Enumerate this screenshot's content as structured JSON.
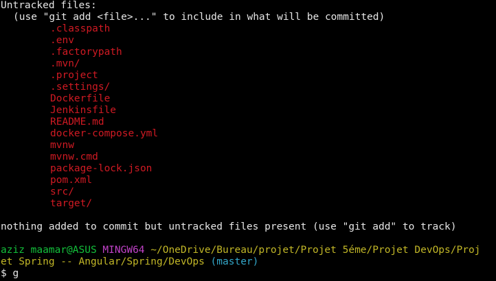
{
  "terminal": {
    "colors": {
      "background": "#000000",
      "text": "#e6e6e6",
      "untracked_file": "#d01a23",
      "prompt_user": "#13c13b",
      "prompt_system": "#c142c8",
      "prompt_path": "#c2b727",
      "prompt_branch": "#33a7c9"
    },
    "header": "Untracked files:",
    "hint": "(use \"git add <file>...\" to include in what will be committed)",
    "untracked_files": [
      ".classpath",
      ".env",
      ".factorypath",
      ".mvn/",
      ".project",
      ".settings/",
      "Dockerfile",
      "Jenkinsfile",
      "README.md",
      "docker-compose.yml",
      "mvnw",
      "mvnw.cmd",
      "package-lock.json",
      "pom.xml",
      "src/",
      "target/"
    ],
    "summary": "nothing added to commit but untracked files present (use \"git add\" to track)",
    "prompt": {
      "user_host": "aziz maamar@ASUS",
      "system": "MINGW64",
      "path_line1": "~/OneDrive/Bureau/projet/Projet 5éme/Projet DevOps/Proj",
      "path_line2": "et Spring -- Angular/Spring/DevOps",
      "branch": "(master)",
      "symbol": "$",
      "input": "g"
    }
  }
}
